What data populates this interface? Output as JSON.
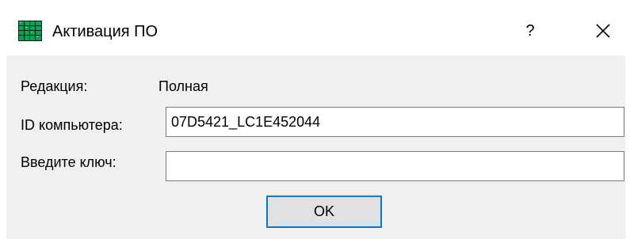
{
  "window": {
    "title": "Активация ПО",
    "help_label": "?",
    "icon": "app-grid-icon",
    "close_icon": "close-icon"
  },
  "form": {
    "edition_label": "Редакция:",
    "edition_value": "Полная",
    "computer_id_label": "ID компьютера:",
    "computer_id_value": "07D5421_LC1E452044",
    "key_label": "Введите ключ:",
    "key_value": "",
    "ok_label": "OK"
  },
  "colors": {
    "accent": "#0078d7",
    "icon_green": "#00a651",
    "icon_dark": "#1a1a1a"
  }
}
